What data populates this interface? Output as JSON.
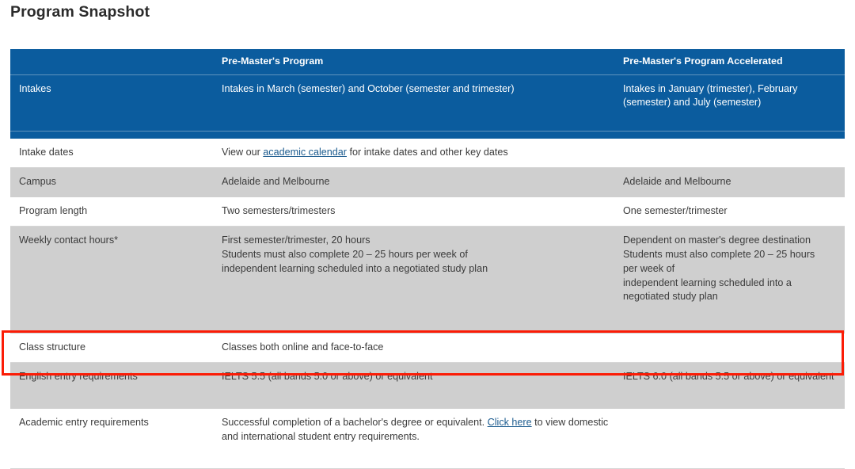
{
  "page": {
    "title": "Program Snapshot"
  },
  "colors": {
    "header_blue": "#0b5c9e",
    "shaded_row": "#cfcfcf",
    "link": "#1d5c8f",
    "highlight_border": "#fb1c06"
  },
  "table": {
    "columns": [
      {
        "id": "attribute",
        "label": ""
      },
      {
        "id": "premasters",
        "label": "Pre-Master's Program"
      },
      {
        "id": "premasters_accelerated",
        "label": "Pre-Master's Program Accelerated"
      }
    ],
    "rows": [
      {
        "style": "blue",
        "attribute": "Intakes",
        "premasters": "Intakes in March (semester) and October (semester and trimester)",
        "premasters_accelerated": "Intakes in January (trimester), February (semester) and July (semester)"
      },
      {
        "style": "plain",
        "attribute": "Intake dates",
        "premasters_prefix": "View our ",
        "premasters_link": "academic calendar",
        "premasters_suffix": " for intake dates and other key dates",
        "premasters_accelerated": ""
      },
      {
        "style": "shaded",
        "attribute": "Campus",
        "premasters": "Adelaide and Melbourne",
        "premasters_accelerated": "Adelaide and Melbourne"
      },
      {
        "style": "plain",
        "attribute": "Program length",
        "premasters": "Two semesters/trimesters",
        "premasters_accelerated": "One semester/trimester"
      },
      {
        "style": "shaded",
        "attribute": "Weekly contact hours*",
        "premasters": "First semester/trimester, 20 hours\nStudents must also complete 20 – 25 hours per week of\nindependent learning scheduled into a negotiated study plan",
        "premasters_accelerated": "Dependent on master's degree destination\nStudents must also complete 20 – 25 hours\nper week of\nindependent learning scheduled into a\nnegotiated study plan"
      },
      {
        "style": "plain",
        "attribute": "Class structure",
        "premasters": "Classes both online and face-to-face",
        "premasters_accelerated": ""
      },
      {
        "style": "shaded",
        "attribute": "English entry requirements",
        "premasters": "IELTS 5.5 (all bands 5.0 or above) or equivalent",
        "premasters_accelerated": "IELTS 6.0 (all bands 5.5 or above) or equivalent",
        "highlighted": true
      },
      {
        "style": "plain",
        "attribute": "Academic entry requirements",
        "premasters_prefix": "Successful completion of a bachelor's degree or equivalent. ",
        "premasters_link": "Click here",
        "premasters_suffix": " to view domestic and international student entry requirements.",
        "premasters_accelerated": ""
      }
    ]
  }
}
